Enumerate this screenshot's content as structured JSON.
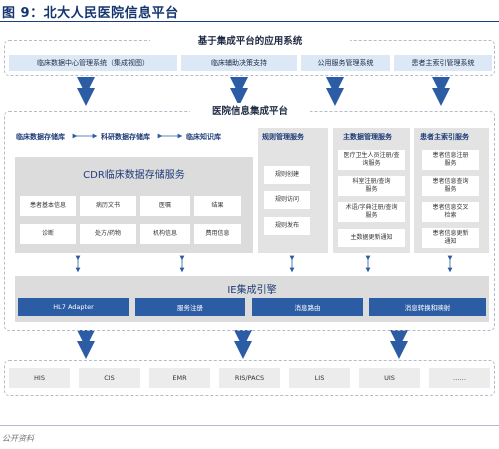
{
  "figure": {
    "title": "图 9：北大人民医院信息平台"
  },
  "app_layer": {
    "title": "基于集成平台的应用系统",
    "systems": [
      "临床数据中心管理系统（集成视图）",
      "临床辅助决策支持",
      "公用服务管理系统",
      "患者主索引管理系统"
    ]
  },
  "integration_platform": {
    "title": "医院信息集成平台",
    "repos": [
      "临床数据存储库",
      "科研数据存储库",
      "临床知识库"
    ],
    "cdr": {
      "title": "CDR临床数据存储服务",
      "items": [
        "患者基本信息",
        "病历文书",
        "医嘱",
        "结果",
        "诊断",
        "处方/药物",
        "机构信息",
        "费用信息"
      ]
    },
    "rules_service": {
      "title": "规则管理服务",
      "items": [
        "规则创建",
        "规则访问",
        "规则发布"
      ]
    },
    "master_data_service": {
      "title": "主数据管理服务",
      "items": [
        "医疗卫生人员注册/查询服务",
        "科室注册/查询服务",
        "术语/字典注册/查询服务",
        "主数据更新通知"
      ]
    },
    "mpi_service": {
      "title": "患者主索引服务",
      "items": [
        "患者信息注册服务",
        "患者信息查询服务",
        "患者信息交叉检索",
        "患者信息更新通知"
      ]
    }
  },
  "ie_engine": {
    "title": "IE集成引擎",
    "components": [
      "HL7 Adapter",
      "服务注册",
      "消息路由",
      "消息转换和映射"
    ]
  },
  "source_systems": [
    "HIS",
    "CIS",
    "EMR",
    "RIS/PACS",
    "LIS",
    "UIS",
    "……"
  ],
  "source_note": "公开资料",
  "colors": {
    "title_blue": "#15356e",
    "app_box": "#dce8f5",
    "engine_blue": "#2c5ca4",
    "panel_gray": "#dcdcdc",
    "arrow_blue": "#2c5ca4"
  }
}
